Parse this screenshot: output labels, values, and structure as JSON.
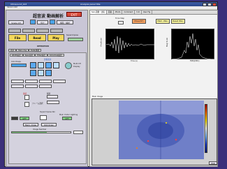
{
  "window": {
    "title": "Ultrasound_GUI",
    "center_title": "Analysis panel title",
    "menu_text": "Version GUI"
  },
  "left": {
    "title": "超音波 動画解析",
    "exit_label": "EXIT",
    "single_label": "Single CH",
    "btn_stop": "停止",
    "btn_save": "保存・解析",
    "btn_file": "File",
    "btn_read": "Read",
    "btn_play": "Play",
    "superimpose": "Superimpose",
    "operation": "OPERATION",
    "tabs": [
      "表示",
      "Main img",
      "Data 解析"
    ],
    "subtabs": [
      "Width設定",
      "Spec設定",
      "Filter設定",
      "Colormap設定"
    ],
    "mode_label": "比較表示",
    "colormap": "Colormaps",
    "multi_ch": "Multi CH",
    "display": "Display",
    "cont": "連続",
    "single": "個別",
    "frame_label": "フレーム選択",
    "superimpose_roi": "Superimpose Roi",
    "main_under": "Main Under Lighting",
    "off": "OFF",
    "image_number": "Image Number",
    "btn_mem_draw": "Mem. Draw",
    "btn_roi_draw": "ROI Draw"
  },
  "right": {
    "tabs": [
      "Sub-画像・比較",
      "画素",
      "Photo",
      "Comment",
      "3-D",
      "User Fig"
    ],
    "time_step": "Time Step",
    "move_label": "Move(ST)",
    "btn_mem_wave": "Mem. Wav.",
    "btn_reset_wave": "Reset Wav.",
    "plot1_xlabel": "Time (s)",
    "plot1_ylabel": "Amplitude",
    "plot2_xlabel": "FREQ(MHz)",
    "plot2_ylabel": "Magnitude",
    "main_image_label": "Main Image",
    "pan": "PAN"
  }
}
